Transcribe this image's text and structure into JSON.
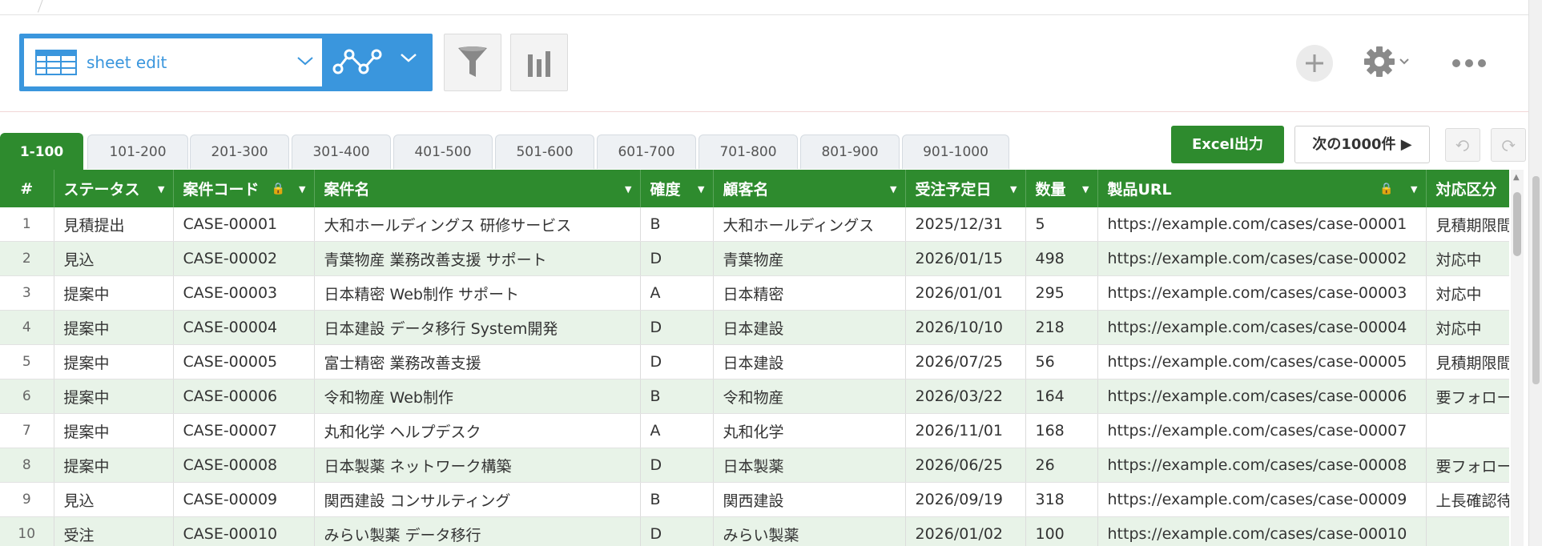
{
  "view_selector": {
    "label": "sheet edit",
    "icon": "sheet-grid-icon"
  },
  "toolbar": {
    "graph_icon": "line-graph-icon",
    "filter_icon": "filter-funnel-icon",
    "chart_icon": "bar-chart-icon",
    "add_icon": "plus-icon",
    "settings_icon": "gear-icon",
    "more_icon": "more-dots-icon"
  },
  "page_tabs": [
    "1-100",
    "101-200",
    "201-300",
    "301-400",
    "401-500",
    "501-600",
    "601-700",
    "701-800",
    "801-900",
    "901-1000"
  ],
  "active_tab": "1-100",
  "actions": {
    "excel_export": "Excel出力",
    "next_1000": "次の1000件 ▶",
    "undo_icon": "undo-icon",
    "redo_icon": "redo-icon"
  },
  "columns": [
    "#",
    "ステータス",
    "案件コード",
    "案件名",
    "確度",
    "顧客名",
    "受注予定日",
    "数量",
    "製品URL",
    "対応区分"
  ],
  "rows": [
    [
      "1",
      "見積提出",
      "CASE-00001",
      "大和ホールディングス 研修サービス",
      "B",
      "大和ホールディングス",
      "2025/12/31",
      "5",
      "https://example.com/cases/case-00001",
      "見積期限間"
    ],
    [
      "2",
      "見込",
      "CASE-00002",
      "青葉物産 業務改善支援 サポート",
      "D",
      "青葉物産",
      "2026/01/15",
      "498",
      "https://example.com/cases/case-00002",
      "対応中"
    ],
    [
      "3",
      "提案中",
      "CASE-00003",
      "日本精密 Web制作 サポート",
      "A",
      "日本精密",
      "2026/01/01",
      "295",
      "https://example.com/cases/case-00003",
      "対応中"
    ],
    [
      "4",
      "提案中",
      "CASE-00004",
      "日本建設 データ移行 System開発",
      "D",
      "日本建設",
      "2026/10/10",
      "218",
      "https://example.com/cases/case-00004",
      "対応中"
    ],
    [
      "5",
      "提案中",
      "CASE-00005",
      "富士精密 業務改善支援",
      "D",
      "日本建設",
      "2026/07/25",
      "56",
      "https://example.com/cases/case-00005",
      "見積期限間"
    ],
    [
      "6",
      "提案中",
      "CASE-00006",
      "令和物産 Web制作",
      "B",
      "令和物産",
      "2026/03/22",
      "164",
      "https://example.com/cases/case-00006",
      "要フォロー"
    ],
    [
      "7",
      "提案中",
      "CASE-00007",
      "丸和化学 ヘルプデスク",
      "A",
      "丸和化学",
      "2026/11/01",
      "168",
      "https://example.com/cases/case-00007",
      ""
    ],
    [
      "8",
      "提案中",
      "CASE-00008",
      "日本製薬 ネットワーク構築",
      "D",
      "日本製薬",
      "2026/06/25",
      "26",
      "https://example.com/cases/case-00008",
      "要フォロー"
    ],
    [
      "9",
      "見込",
      "CASE-00009",
      "関西建設 コンサルティング",
      "B",
      "関西建設",
      "2026/09/19",
      "318",
      "https://example.com/cases/case-00009",
      "上長確認待"
    ],
    [
      "10",
      "受注",
      "CASE-00010",
      "みらい製薬 データ移行",
      "D",
      "みらい製薬",
      "2026/01/02",
      "100",
      "https://example.com/cases/case-00010",
      ""
    ]
  ]
}
